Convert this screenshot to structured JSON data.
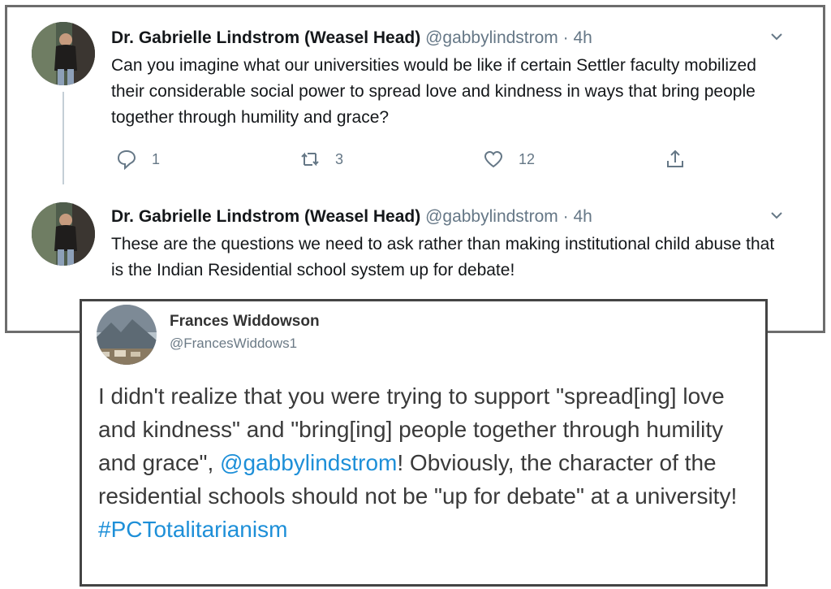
{
  "thread": {
    "tweets": [
      {
        "name": "Dr. Gabrielle Lindstrom (Weasel Head)",
        "handle": "@gabbylindstrom",
        "separator": "·",
        "time": "4h",
        "text": "Can you imagine what our universities would be like if certain Settler faculty mobilized their considerable social power to spread love and kindness in ways that bring people together through humility and grace?",
        "reply_count": "1",
        "retweet_count": "3",
        "like_count": "12"
      },
      {
        "name": "Dr. Gabrielle Lindstrom (Weasel Head)",
        "handle": "@gabbylindstrom",
        "separator": "·",
        "time": "4h",
        "text": "These are the questions we need to ask rather than making institutional child abuse that is the Indian Residential school system up for debate!"
      }
    ],
    "icons": [
      "reply-icon",
      "retweet-icon",
      "like-icon",
      "share-icon",
      "chevron-down-icon"
    ]
  },
  "reply": {
    "name": "Frances Widdowson",
    "handle": "@FrancesWiddows1",
    "text_part1": "I didn't realize that you were trying to support \"spread[ing] love and kindness\" and \"bring[ing] people together through humility and grace\",",
    "mention": "@gabbylindstrom",
    "text_part2": "! Obviously, the character of the residential schools should not be \"up for debate\" at a university!",
    "hashtag": "#PCTotalitarianism"
  },
  "colors": {
    "link": "#1d8fd8",
    "secondary_text": "#657786",
    "border": "#6d6d6d"
  }
}
